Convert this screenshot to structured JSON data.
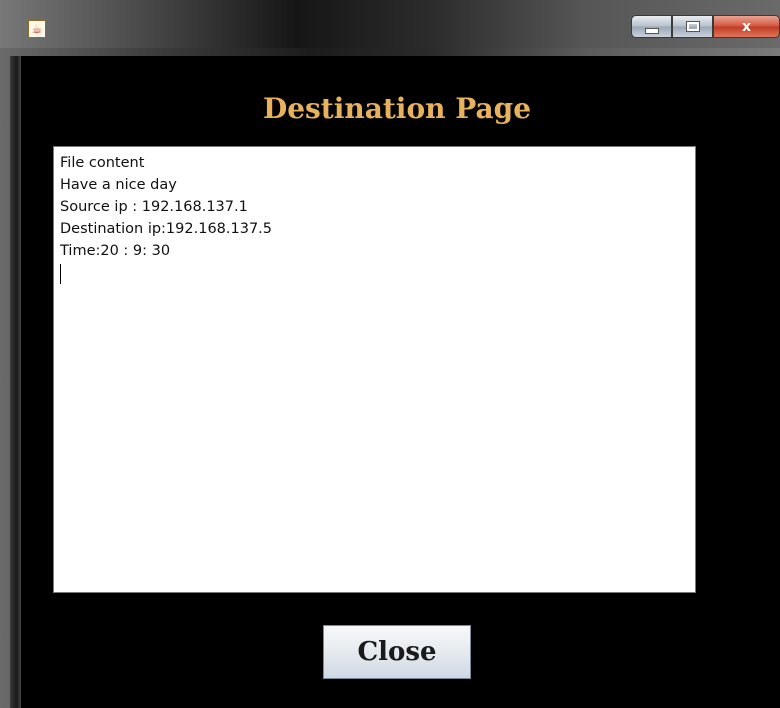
{
  "window": {
    "app_icon": "java-cup-icon",
    "controls": {
      "minimize_icon": "minimize-icon",
      "maximize_icon": "maximize-icon",
      "close_label": "x"
    }
  },
  "page": {
    "title": "Destination Page",
    "content_lines": [
      "File content",
      "Have a nice day",
      "Source ip : 192.168.137.1",
      "Destination ip:192.168.137.5",
      "Time:20 : 9: 30"
    ],
    "close_button_label": "Close"
  },
  "colors": {
    "title_text": "#e8b15c",
    "client_background": "#000000",
    "content_background": "#ffffff"
  }
}
